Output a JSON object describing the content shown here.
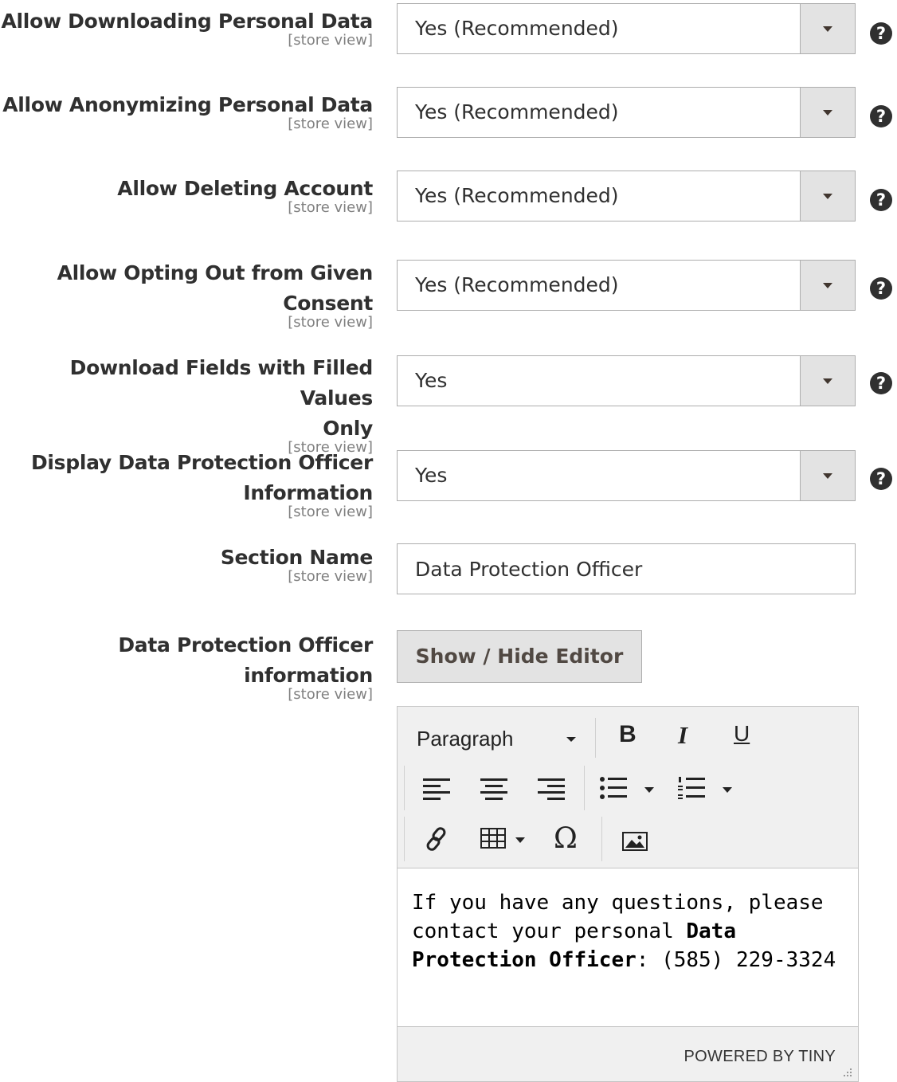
{
  "scope_label": "[store view]",
  "help_glyph": "?",
  "fields": [
    {
      "label_lines": [
        "Allow Downloading Personal Data"
      ],
      "value": "Yes (Recommended)"
    },
    {
      "label_lines": [
        "Allow Anonymizing Personal Data"
      ],
      "value": "Yes (Recommended)"
    },
    {
      "label_lines": [
        "Allow Deleting Account"
      ],
      "value": "Yes (Recommended)"
    },
    {
      "label_lines": [
        "Allow Opting Out from Given",
        "Consent"
      ],
      "value": "Yes (Recommended)"
    },
    {
      "label_lines": [
        "Download Fields with Filled Values",
        "Only"
      ],
      "value": "Yes"
    },
    {
      "label_lines": [
        "Display Data Protection Officer",
        "Information"
      ],
      "value": "Yes"
    }
  ],
  "section_name": {
    "label": "Section Name",
    "value": "Data Protection Officer"
  },
  "dpo_info": {
    "label_lines": [
      "Data Protection Officer",
      "information"
    ],
    "toggle_button": "Show / Hide Editor"
  },
  "editor": {
    "format_select": "Paragraph",
    "bold": "B",
    "italic": "I",
    "underline": "U",
    "special_char": "Ω",
    "content_plain_1": "If you have any questions, please contact your personal ",
    "content_bold": "Data Protection Officer",
    "content_plain_2": ": (585) 229-3324",
    "powered_by": "POWERED BY TINY"
  }
}
